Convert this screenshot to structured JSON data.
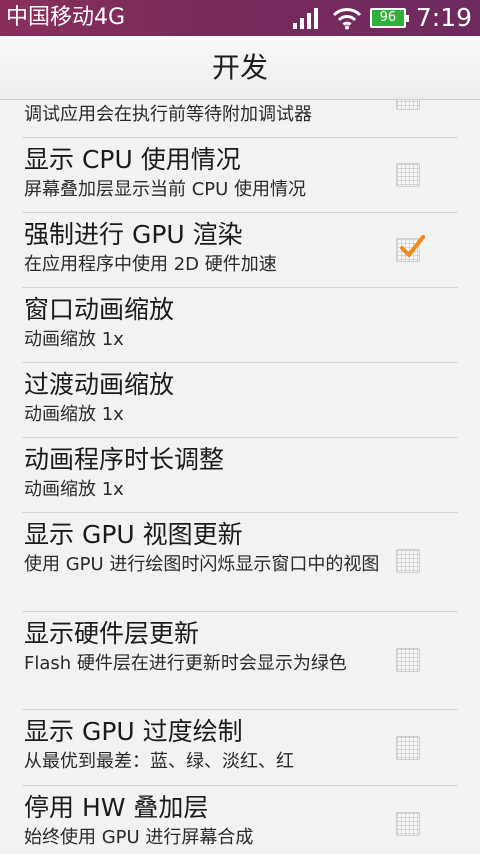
{
  "status_bar": {
    "carrier": "中国移动4G",
    "battery_level": "96",
    "time": "7:19",
    "icons": [
      "signal-icon",
      "wifi-icon",
      "battery-icon"
    ],
    "colors": {
      "background": "#7a2a5a",
      "battery_fill": "#2fb03a"
    }
  },
  "header": {
    "title": "开发"
  },
  "settings": [
    {
      "title": "",
      "summary": "调试应用会在执行前等待附加调试器",
      "checkbox": true,
      "checked": false
    },
    {
      "title": "显示 CPU 使用情况",
      "summary": "屏幕叠加层显示当前 CPU 使用情况",
      "checkbox": true,
      "checked": false
    },
    {
      "title": "强制进行 GPU 渲染",
      "summary": "在应用程序中使用 2D 硬件加速",
      "checkbox": true,
      "checked": true
    },
    {
      "title": "窗口动画缩放",
      "summary": "动画缩放 1x",
      "checkbox": false
    },
    {
      "title": "过渡动画缩放",
      "summary": "动画缩放 1x",
      "checkbox": false
    },
    {
      "title": "动画程序时长调整",
      "summary": "动画缩放 1x",
      "checkbox": false
    },
    {
      "title": "显示 GPU 视图更新",
      "summary": "使用 GPU 进行绘图时闪烁显示窗口中的视图",
      "checkbox": true,
      "checked": false
    },
    {
      "title": "显示硬件层更新",
      "summary": "Flash 硬件层在进行更新时会显示为绿色",
      "checkbox": true,
      "checked": false
    },
    {
      "title": "显示 GPU 过度绘制",
      "summary": "从最优到最差：蓝、绿、淡红、红",
      "checkbox": true,
      "checked": false
    },
    {
      "title": "停用 HW 叠加层",
      "summary": "始终使用 GPU 进行屏幕合成",
      "checkbox": true,
      "checked": false
    }
  ],
  "colors": {
    "check_mark": "#f08a1c",
    "list_background": "#f2f2f0"
  }
}
